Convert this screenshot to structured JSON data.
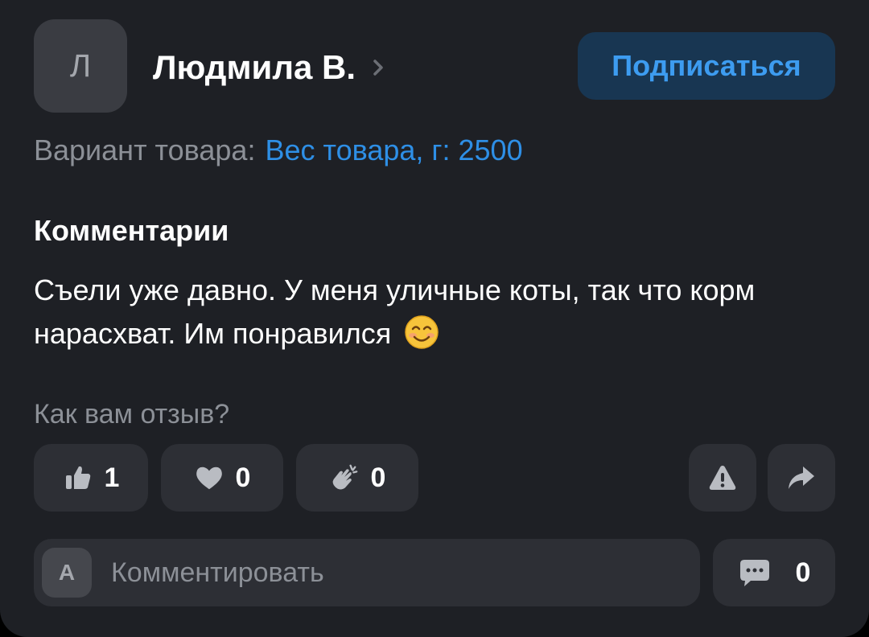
{
  "review": {
    "author": {
      "initial": "Л",
      "name": "Людмила В."
    },
    "subscribe_label": "Подписаться",
    "variant": {
      "label": "Вариант товара:",
      "value": "Вес товара, г: 2500"
    },
    "comments_heading": "Комментарии",
    "comment_text": "Съели уже давно. У меня уличные коты, так что корм нарасхват. Им понравился",
    "comment_emoji": "smiling-face-emoji",
    "question": "Как вам отзыв?",
    "reactions": [
      {
        "icon": "thumbs-up-icon",
        "count": "1"
      },
      {
        "icon": "heart-icon",
        "count": "0"
      },
      {
        "icon": "clapping-hands-icon",
        "count": "0"
      }
    ],
    "actions": [
      {
        "icon": "report-warning-icon"
      },
      {
        "icon": "share-arrow-icon"
      }
    ],
    "comment_input": {
      "avatar_initial": "А",
      "placeholder": "Комментировать"
    },
    "comments_count": "0"
  },
  "colors": {
    "card_background": "#1e2025",
    "accent_blue": "#2e8fe6",
    "subscribe_bg": "#183652",
    "secondary_text": "#8c9097",
    "chip_bg": "#2d2f35"
  }
}
